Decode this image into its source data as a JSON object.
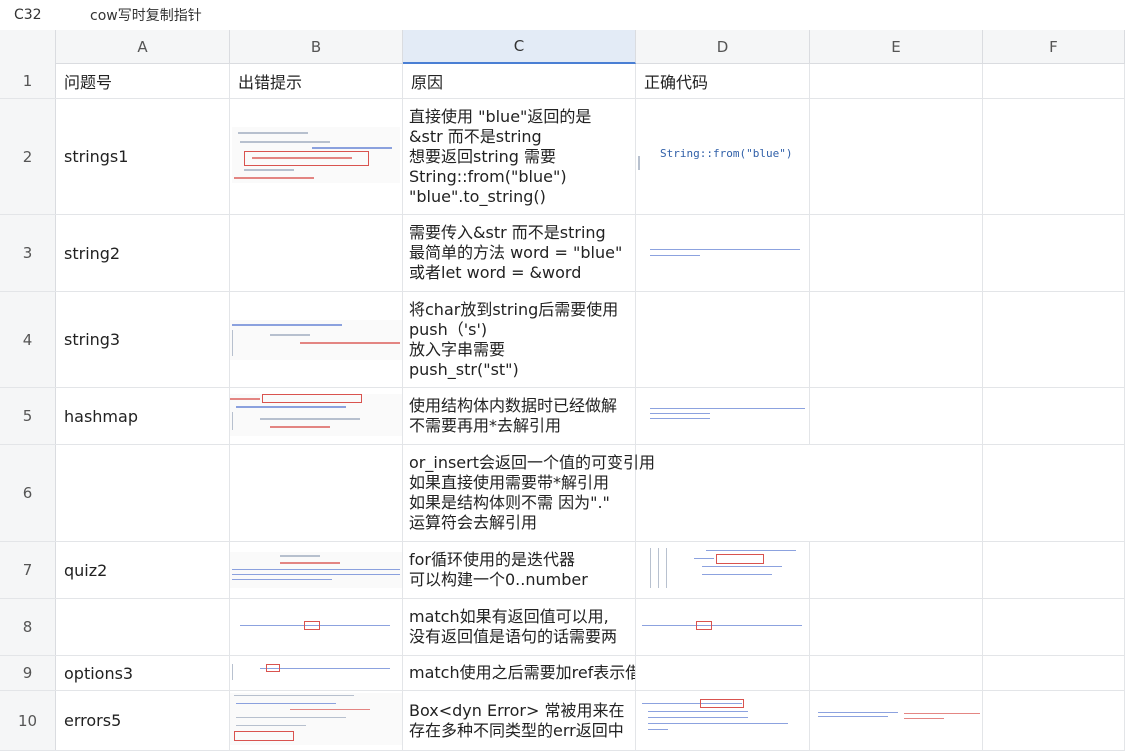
{
  "formula_bar": {
    "cell_ref": "C32",
    "content": "cow写时复制指针"
  },
  "columns": [
    "A",
    "B",
    "C",
    "D",
    "E",
    "F"
  ],
  "active_column": "C",
  "rows": [
    {
      "num": "1",
      "a": "问题号",
      "b": "出错提示",
      "c": [
        "原因"
      ],
      "d": "正确代码"
    },
    {
      "num": "2",
      "a": "strings1",
      "c": [
        "直接使用 \"blue\"返回的是",
        "&str  而不是string",
        "想要返回string 需要",
        "String::from(\"blue\")",
        "\"blue\".to_string()"
      ],
      "d_code": "String::from(\"blue\")"
    },
    {
      "num": "3",
      "a": "string2",
      "c": [
        "需要传入&str 而不是string",
        "最简单的方法 word = \"blue\"",
        "或者let word = &word"
      ]
    },
    {
      "num": "4",
      "a": "string3",
      "c": [
        "将char放到string后需要使用",
        "push（'s')",
        "放入字串需要",
        "push_str(\"st\")"
      ]
    },
    {
      "num": "5",
      "a": "hashmap",
      "c": [
        "使用结构体内数据时已经做解",
        "不需要再用*去解引用"
      ]
    },
    {
      "num": "6",
      "a": "",
      "c": [
        "or_insert会返回一个值的可变引用",
        "如果直接使用需要带*解引用",
        "如果是结构体则不需  因为\".\"",
        "运算符会去解引用"
      ]
    },
    {
      "num": "7",
      "a": "quiz2",
      "c": [
        "for循环使用的是迭代器",
        "可以构建一个0..number"
      ]
    },
    {
      "num": "8",
      "a": "",
      "c": [
        "match如果有返回值可以用,",
        "没有返回值是语句的话需要两"
      ]
    },
    {
      "num": "9",
      "a": "options3",
      "c": [
        "match使用之后需要加ref表示借用"
      ]
    },
    {
      "num": "10",
      "a": "errors5",
      "c": [
        "Box<dyn Error> 常被用来在",
        "存在多种不同类型的err返回中"
      ]
    }
  ]
}
